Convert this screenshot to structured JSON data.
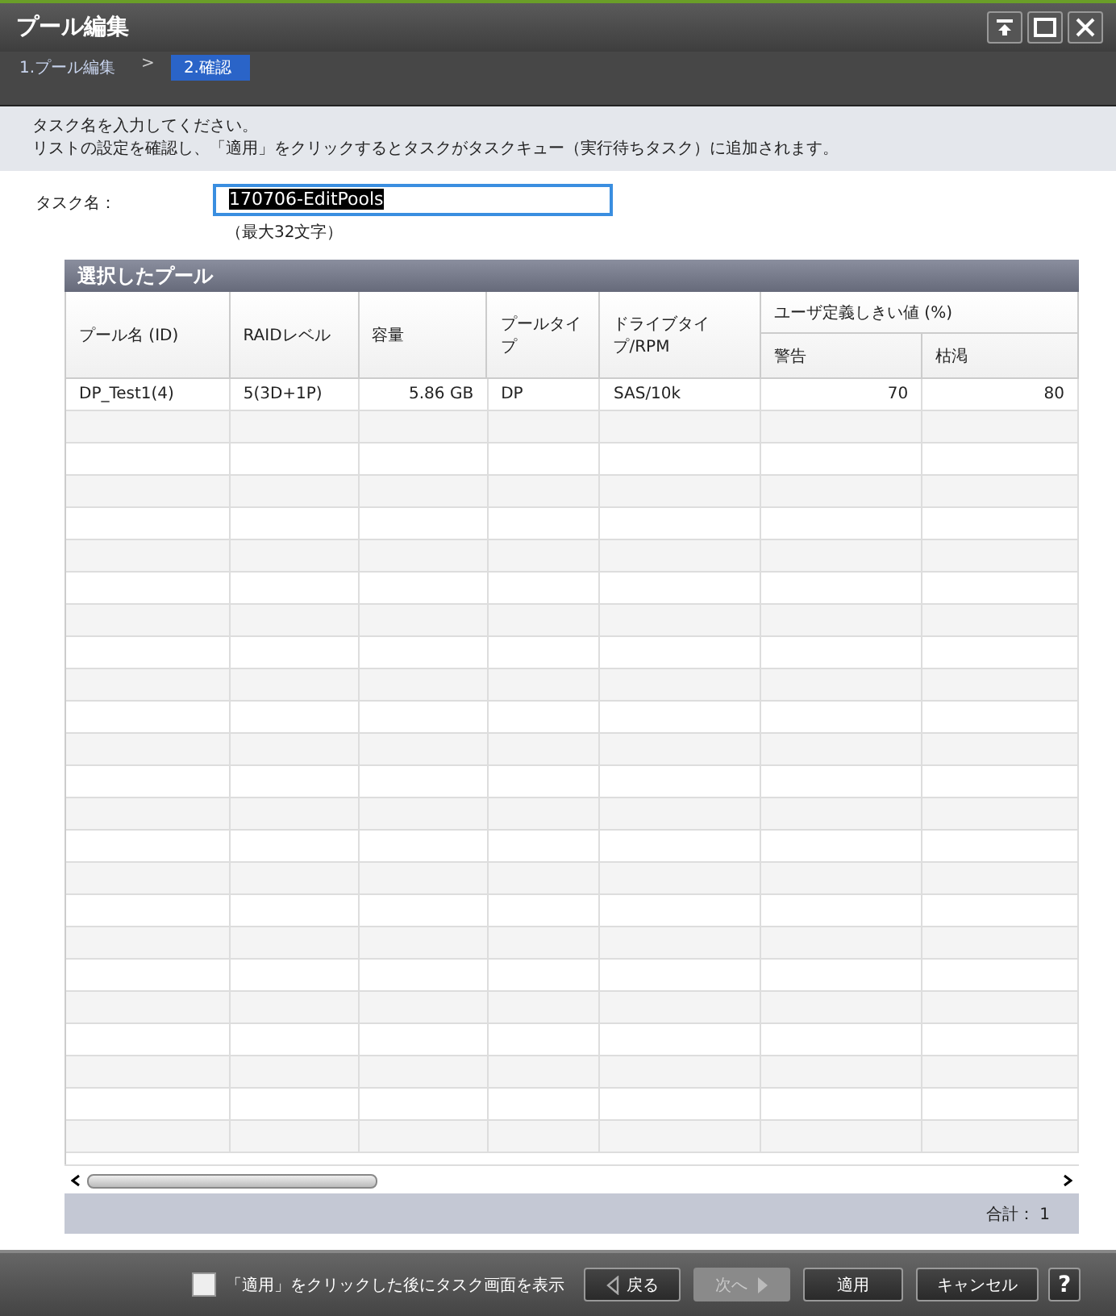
{
  "window": {
    "title": "プール編集"
  },
  "steps": [
    {
      "label": "1.プール編集",
      "selected": false
    },
    {
      "label": ">",
      "kind": "separator"
    },
    {
      "label": "2.確認",
      "selected": true
    }
  ],
  "instructions": [
    "タスク名を入力してください。",
    "リストの設定を確認し、「適用」をクリックするとタスクがタスクキュー（実行待ちタスク）に追加されます。"
  ],
  "task_name": {
    "label": "タスク名：",
    "value": "170706-EditPools",
    "hint": "（最大32文字）"
  },
  "table": {
    "title": "選択したプール",
    "columns": [
      "プール名 (ID)",
      "RAIDレベル",
      "容量",
      "プールタイプ",
      "ドライブタイプ/RPM"
    ],
    "group_column": {
      "label": "ユーザ定義しきい値 (%)",
      "columns": [
        "警告",
        "枯渇"
      ]
    },
    "rows": [
      [
        "DP_Test1(4)",
        "5(3D+1P)",
        "5.86 GB",
        "DP",
        "SAS/10k",
        "70",
        "80"
      ]
    ],
    "total": "合計：  1"
  },
  "footer": {
    "checkbox": {
      "label": "「適用」をクリックした後にタスク画面を表示",
      "checked": false
    },
    "buttons": [
      {
        "label": "戻る",
        "kind": "back",
        "disabled": false
      },
      {
        "label": "次へ",
        "kind": "next",
        "disabled": true
      },
      {
        "label": "適用",
        "kind": "plain",
        "disabled": false
      },
      {
        "label": "キャンセル",
        "kind": "plain",
        "disabled": false
      },
      {
        "label": "?",
        "kind": "help",
        "disabled": false
      }
    ]
  }
}
